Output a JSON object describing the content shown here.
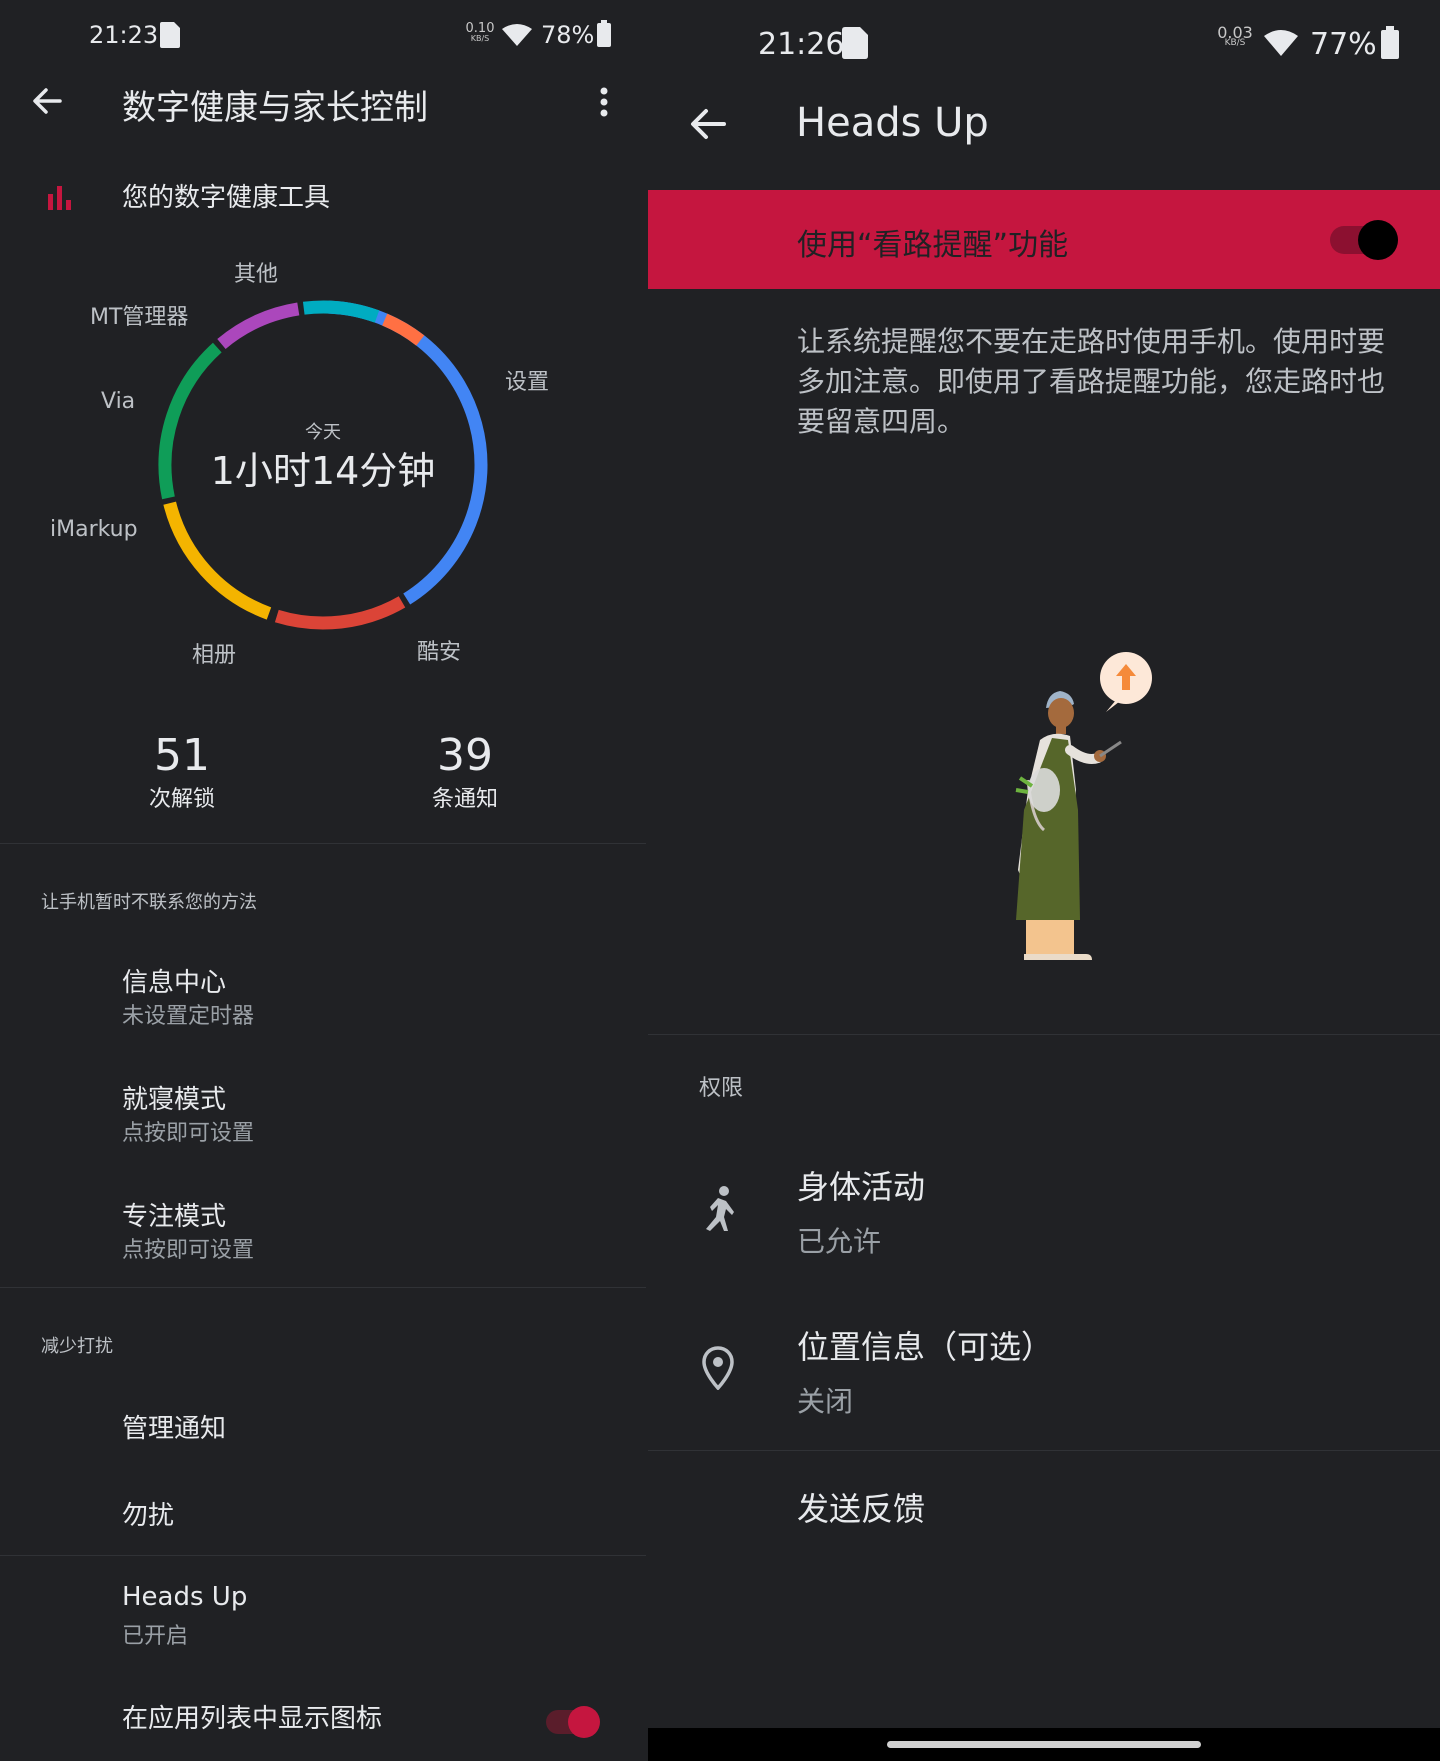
{
  "left": {
    "status_bar": {
      "time": "21:23",
      "net_speed_value": "0.10",
      "net_speed_unit": "KB/S",
      "battery": "78%"
    },
    "header": {
      "title": "数字健康与家长控制"
    },
    "tools_title": "您的数字健康工具",
    "chart_data": {
      "type": "pie",
      "center_caption": "今天",
      "center_value": "1小时14分钟",
      "slices": [
        {
          "name": "设置",
          "color": "#4285f4"
        },
        {
          "name": "酷安",
          "color": "#db4437"
        },
        {
          "name": "相册",
          "color": "#f4b400"
        },
        {
          "name": "iMarkup",
          "color": "#0f9d58"
        },
        {
          "name": "Via",
          "color": "#ab47bc"
        },
        {
          "name": "MT管理器",
          "color": "#00acc1"
        },
        {
          "name": "其他",
          "color": "#ff7043"
        }
      ]
    },
    "stats": {
      "unlocks_value": "51",
      "unlocks_label": "次解锁",
      "notifications_value": "39",
      "notifications_label": "条通知"
    },
    "disconnect_section": {
      "title": "让手机暂时不联系您的方法",
      "items": [
        {
          "title": "信息中心",
          "subtitle": "未设置定时器"
        },
        {
          "title": "就寝模式",
          "subtitle": "点按即可设置"
        },
        {
          "title": "专注模式",
          "subtitle": "点按即可设置"
        }
      ]
    },
    "reduce_section": {
      "title": "减少打扰",
      "items": [
        {
          "title": "管理通知"
        },
        {
          "title": "勿扰"
        }
      ]
    },
    "heads_up": {
      "title": "Heads Up",
      "subtitle": "已开启"
    },
    "show_icon": {
      "title": "在应用列表中显示图标",
      "on": true
    },
    "accent": "#c5163f"
  },
  "right": {
    "status_bar": {
      "time": "21:26",
      "net_speed_value": "0.03",
      "net_speed_unit": "KB/S",
      "battery": "77%"
    },
    "header": {
      "title": "Heads Up"
    },
    "main_toggle": {
      "label": "使用“看路提醒”功能",
      "on": true,
      "bg_color": "#c5163f"
    },
    "description": "让系统提醒您不要在走路时使用手机。使用时要多加注意。即使用了看路提醒功能，您走路时也要留意四周。",
    "permissions": {
      "title": "权限",
      "items": [
        {
          "title": "身体活动",
          "subtitle": "已允许",
          "icon": "running-icon"
        },
        {
          "title": "位置信息（可选）",
          "subtitle": "关闭",
          "icon": "location-pin-icon"
        }
      ]
    },
    "feedback": {
      "title": "发送反馈"
    }
  }
}
